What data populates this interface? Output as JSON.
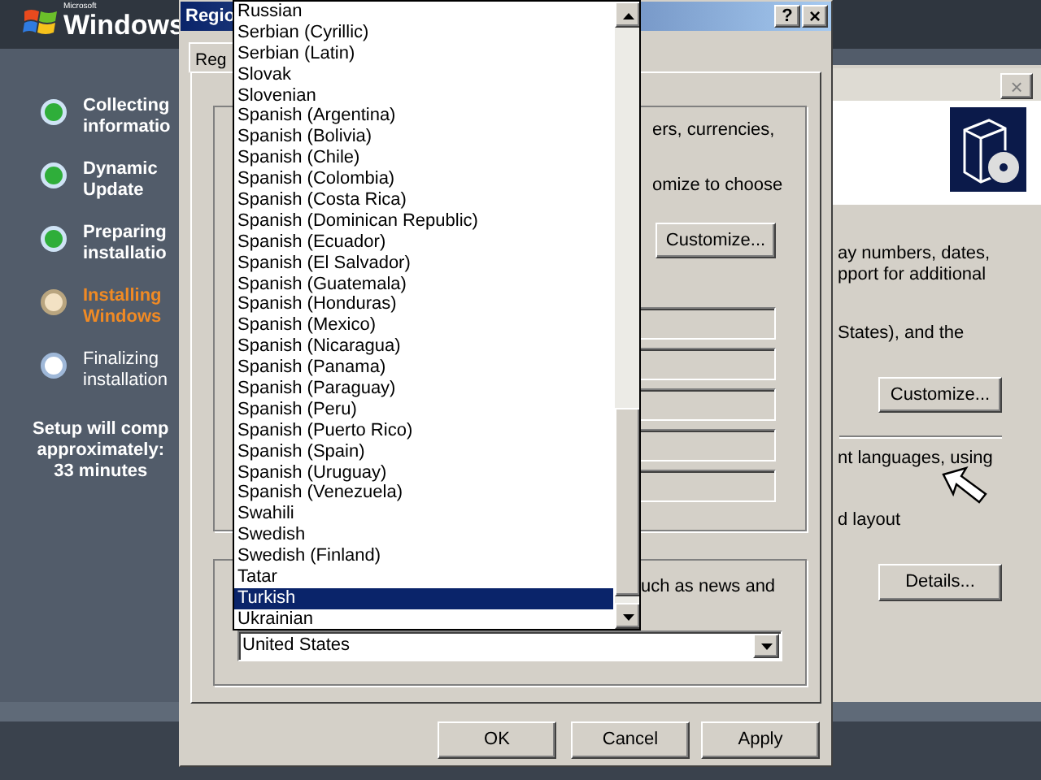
{
  "setup_sidebar": {
    "logo_caption": "Microsoft",
    "logo_text": "Windows",
    "steps": [
      {
        "lines": [
          "Collecting",
          "informatio"
        ],
        "done": true,
        "current": false
      },
      {
        "lines": [
          "Dynamic",
          "Update"
        ],
        "done": true,
        "current": false
      },
      {
        "lines": [
          "Preparing",
          "installatio"
        ],
        "done": true,
        "current": false
      },
      {
        "lines": [
          "Installing",
          "Windows"
        ],
        "done": false,
        "current": true
      },
      {
        "lines": [
          "Finalizing",
          "installation"
        ],
        "done": false,
        "current": false
      }
    ],
    "time_note": [
      "Setup will comp",
      "approximately:",
      "33 minutes"
    ]
  },
  "back_window": {
    "close_button": "×",
    "text_1": [
      "ay numbers, dates,",
      "pport for additional"
    ],
    "text_2": "States), and the",
    "button_1": "Customize...",
    "text_3": "nt languages, using",
    "text_4": "d layout",
    "button_2": "Details..."
  },
  "regional_dialog": {
    "title": "Regio",
    "help_button": "?",
    "close_button": "×",
    "tab": {
      "label": "Reg",
      "selected": true
    },
    "group_1": {
      "text_1": "ers, currencies,",
      "text_2": "omize to choose",
      "button": "Customize...",
      "fields": [
        {
          "disabled": true
        },
        {
          "disabled": true
        },
        {
          "disabled": true
        },
        {
          "disabled": true
        },
        {
          "disabled": true
        }
      ]
    },
    "group_2": {
      "text": "uch as news and",
      "combo": {
        "value": "United States"
      }
    },
    "buttons": [
      "OK",
      "Cancel",
      "Apply"
    ],
    "dropdown_list": {
      "items": [
        {
          "label": "Russian",
          "selected": false
        },
        {
          "label": "Serbian (Cyrillic)",
          "selected": false
        },
        {
          "label": "Serbian (Latin)",
          "selected": false
        },
        {
          "label": "Slovak",
          "selected": false
        },
        {
          "label": "Slovenian",
          "selected": false
        },
        {
          "label": "Spanish (Argentina)",
          "selected": false
        },
        {
          "label": "Spanish (Bolivia)",
          "selected": false
        },
        {
          "label": "Spanish (Chile)",
          "selected": false
        },
        {
          "label": "Spanish (Colombia)",
          "selected": false
        },
        {
          "label": "Spanish (Costa Rica)",
          "selected": false
        },
        {
          "label": "Spanish (Dominican Republic)",
          "selected": false
        },
        {
          "label": "Spanish (Ecuador)",
          "selected": false
        },
        {
          "label": "Spanish (El Salvador)",
          "selected": false
        },
        {
          "label": "Spanish (Guatemala)",
          "selected": false
        },
        {
          "label": "Spanish (Honduras)",
          "selected": false
        },
        {
          "label": "Spanish (Mexico)",
          "selected": false
        },
        {
          "label": "Spanish (Nicaragua)",
          "selected": false
        },
        {
          "label": "Spanish (Panama)",
          "selected": false
        },
        {
          "label": "Spanish (Paraguay)",
          "selected": false
        },
        {
          "label": "Spanish (Peru)",
          "selected": false
        },
        {
          "label": "Spanish (Puerto Rico)",
          "selected": false
        },
        {
          "label": "Spanish (Spain)",
          "selected": false
        },
        {
          "label": "Spanish (Uruguay)",
          "selected": false
        },
        {
          "label": "Spanish (Venezuela)",
          "selected": false
        },
        {
          "label": "Swahili",
          "selected": false
        },
        {
          "label": "Swedish",
          "selected": false
        },
        {
          "label": "Swedish (Finland)",
          "selected": false
        },
        {
          "label": "Tatar",
          "selected": false
        },
        {
          "label": "Turkish",
          "selected": true
        },
        {
          "label": "Ukrainian",
          "selected": false
        }
      ]
    }
  }
}
